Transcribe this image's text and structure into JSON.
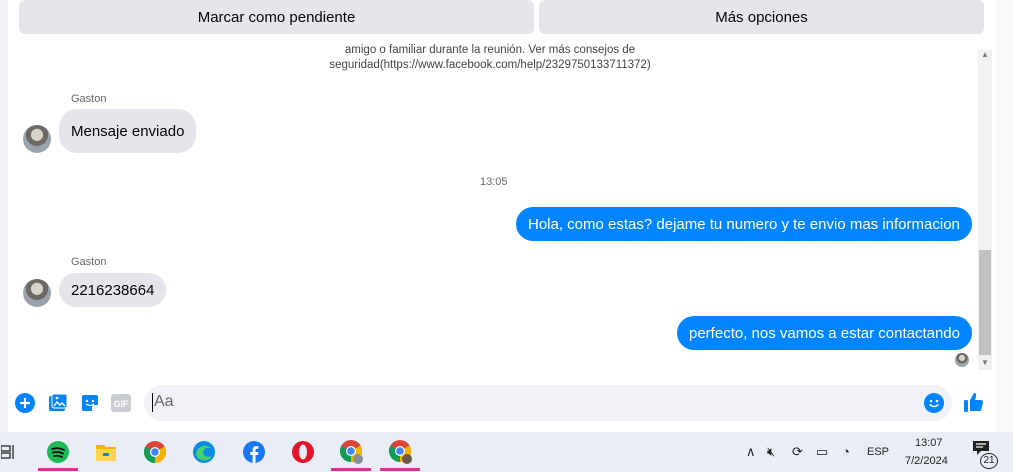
{
  "actions": {
    "mark_pending": "Marcar como pendiente",
    "more_options": "Más opciones"
  },
  "notice": {
    "line1": "amigo o familiar durante la reunión. Ver más consejos de",
    "line2": "seguridad(https://www.facebook.com/help/2329750133711372)"
  },
  "messages": [
    {
      "sender": "Gaston",
      "text": "Mensaje enviado",
      "direction": "incoming"
    },
    {
      "timestamp": "13:05"
    },
    {
      "text": "Hola, como estas? dejame tu numero y te envio mas informacion",
      "direction": "outgoing"
    },
    {
      "sender": "Gaston",
      "text": "2216238664",
      "direction": "incoming"
    },
    {
      "text": "perfecto, nos vamos a estar contactando",
      "direction": "outgoing"
    }
  ],
  "composer": {
    "placeholder": "Aa",
    "icons": [
      "add-icon",
      "photo-icon",
      "sticker-icon",
      "gif-icon",
      "emoji-icon",
      "like-icon"
    ],
    "gif_label": "GIF"
  },
  "taskbar": {
    "apps": [
      "task-view-icon",
      "spotify-icon",
      "file-explorer-icon",
      "chrome-icon",
      "edge-icon",
      "facebook-icon",
      "opera-icon",
      "chrome-profile-icon",
      "chrome-profile-2-icon"
    ],
    "language": "ESP",
    "time": "13:07",
    "date": "7/2/2024",
    "notifications": "21"
  },
  "colors": {
    "accent": "#0084ff",
    "bubble_in": "#e4e6eb",
    "taskbar": "#e9eef6"
  }
}
